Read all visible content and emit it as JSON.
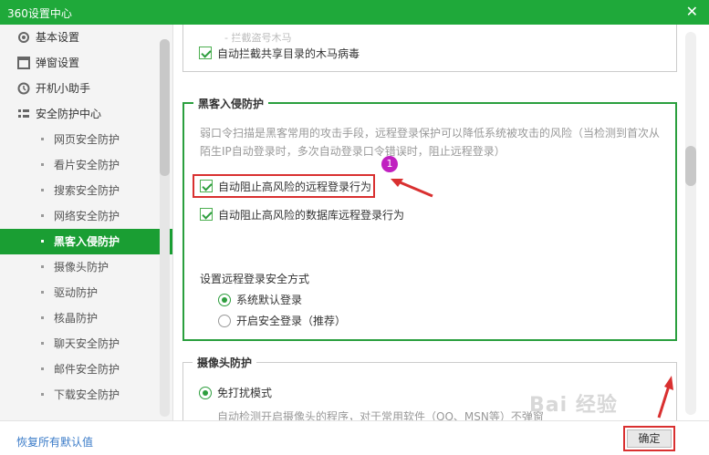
{
  "window": {
    "title": "360设置中心",
    "close_glyph": "✕"
  },
  "sidebar": {
    "items": [
      {
        "label": "基本设置",
        "icon": "gear-icon"
      },
      {
        "label": "弹窗设置",
        "icon": "window-icon"
      },
      {
        "label": "开机小助手",
        "icon": "power-clock-icon"
      },
      {
        "label": "安全防护中心",
        "icon": "shield-icon"
      }
    ],
    "sub_items": [
      "网页安全防护",
      "看片安全防护",
      "搜索安全防护",
      "网络安全防护",
      "黑客入侵防护",
      "摄像头防护",
      "驱动防护",
      "核晶防护",
      "聊天安全防护",
      "邮件安全防护",
      "下载安全防护"
    ],
    "active_sub": "黑客入侵防护"
  },
  "section_prev": {
    "faded_text": "- 拦截盗号木马",
    "checkbox_label": "自动拦截共享目录的木马病毒"
  },
  "hacker_section": {
    "title": "黑客入侵防护",
    "description": "弱口令扫描是黑客常用的攻击手段，远程登录保护可以降低系统被攻击的风险（当检测到首次从陌生IP自动登录时，多次自动登录口令错误时，阻止远程登录）",
    "checkbox1": "自动阻止高风险的远程登录行为",
    "checkbox2": "自动阻止高风险的数据库远程登录行为",
    "mode_label": "设置远程登录安全方式",
    "radio1": "系统默认登录",
    "radio2": "开启安全登录（推荐）",
    "badge": "1"
  },
  "camera_section": {
    "title": "摄像头防护",
    "radio": "免打扰模式",
    "description": "自动检测开启摄像头的程序，对于常用软件（QQ、MSN等）不弹窗"
  },
  "footer": {
    "restore_link": "恢复所有默认值",
    "ok_button": "确定"
  },
  "watermark": "Bai 经验",
  "colors": {
    "accent": "#1fa93a",
    "highlight": "#d93030",
    "badge": "#c020c0"
  }
}
